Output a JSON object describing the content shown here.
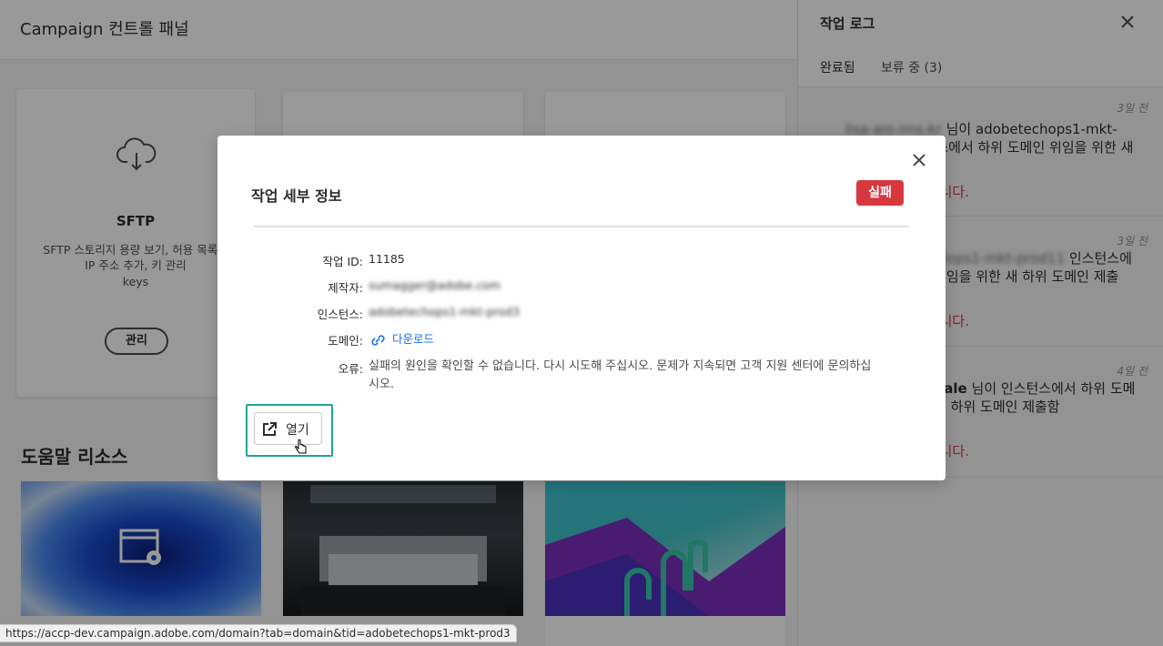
{
  "app": {
    "title": "Campaign 컨트롤 패널"
  },
  "cards": [
    {
      "icon": "cloud-download-icon",
      "title": "SFTP",
      "description": "SFTP 스토리지 용량 보기, 허용 목록에 IP 주소 추가, 키 관리",
      "keys_text": "keys",
      "button_label": "관리"
    }
  ],
  "help": {
    "title": "도움말 리소스"
  },
  "job_log": {
    "title": "작업 로그",
    "tabs": [
      {
        "label": "완료됨",
        "active": true
      },
      {
        "label": "보류 중 (3)",
        "active": false
      }
    ],
    "items": [
      {
        "date": "3일 전",
        "user": "lisa-aio-ims-kr",
        "text_a": "님이",
        "instance": "adobetechops1-mkt-prod11",
        "text_b": "인스턴스에서 하위 도메인 위임을 위한 새 하위 도메인 제출",
        "status": "했습니다."
      },
      {
        "date": "3일 전",
        "user": "",
        "text_a": "님이",
        "instance": "adobetechops1-mkt-prod11",
        "text_b": "인스턴스에서 하위 도메인 위임을 위한 새 하위 도메인 제출",
        "status": "했습니다."
      },
      {
        "date": "4일 전",
        "user": "admin-nokocale",
        "text_a": "님이",
        "instance": "",
        "text_b": "인스턴스에서 하위 도메인 위임을 위한 새 하위 도메인 제출함",
        "status": "했습니다."
      }
    ]
  },
  "modal": {
    "title": "작업 세부 정보",
    "status": "실패",
    "fields": {
      "job_id_label": "작업 ID:",
      "job_id": "11185",
      "creator_label": "제작자:",
      "creator": "sumagger@adobe.com",
      "instance_label": "인스턴스:",
      "instance": "adobetechops1-mkt-prod3",
      "domain_label": "도메인:",
      "domain_link": "다운로드",
      "error_label": "오류:",
      "error": "실패의 원인을 확인할 수 없습니다. 다시 시도해 주십시오. 문제가 지속되면 고객 지원 센터에 문의하십시오."
    },
    "open_button": "열기"
  },
  "statusbar": {
    "url": "https://accp-dev.campaign.adobe.com/domain?tab=domain&tid=adobetechops1-mkt-prod3"
  },
  "colors": {
    "fail": "#d7373f",
    "link": "#1473e6",
    "focus": "#21a597"
  }
}
